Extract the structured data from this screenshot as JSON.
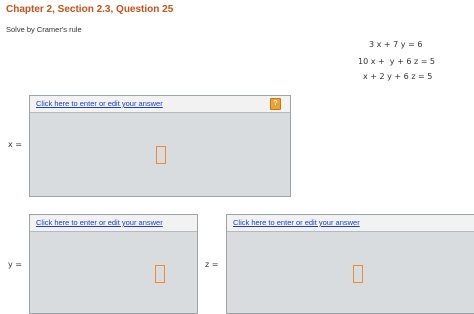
{
  "header": {
    "title": "Chapter 2, Section 2.3, Question 25",
    "instruction": "Solve by Cramer's rule"
  },
  "equations": [
    "3 x + 7 y = 6",
    "10 x +  y + 6 z = 5",
    "x + 2 y + 6 z = 5"
  ],
  "answers": {
    "x": {
      "label": "x =",
      "link": "Click here to enter or edit your answer",
      "help": "?"
    },
    "y": {
      "label": "y =",
      "link": "Click here to enter or edit your answer"
    },
    "z": {
      "label": "z =",
      "link": "Click here to enter or edit your answer"
    }
  },
  "colors": {
    "title": "#c8501a",
    "link": "#1a3fd6",
    "panel_bg": "#d9dcdf",
    "cursor_border": "#f08a30",
    "help_icon": "#f0a030"
  }
}
